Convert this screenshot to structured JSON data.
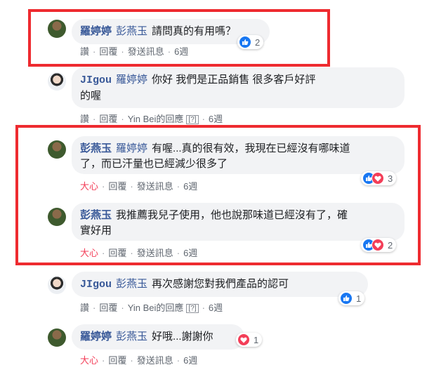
{
  "actions": {
    "like": "讚",
    "love": "大心",
    "reply": "回覆",
    "send": "發送訊息",
    "sep": "·",
    "reply_info_tag": "[?]"
  },
  "comments": [
    {
      "author": "羅婷婷",
      "tag": "彭燕玉",
      "text": "請問真的有用嗎？",
      "reaction": "like",
      "time": "6週",
      "reactions": "2"
    },
    {
      "author": "JIgou",
      "tag": "羅婷婷",
      "text_line1": "你好 我們是正品銷售 很多客戶好評",
      "text_line2": "的喔",
      "reaction": "like",
      "reply_info": "Yin Bei的回應",
      "time": "6週"
    },
    {
      "author": "彭燕玉",
      "tag": "羅婷婷",
      "text_line1": "有喔...真的很有效，我現在已經沒有哪味道",
      "text_line2": "了，而已汗量也已經減少很多了",
      "reaction": "love",
      "time": "6週",
      "reactions": "3"
    },
    {
      "author": "彭燕玉",
      "text_line1": "我推薦我兒子使用，他也說那味道已經沒有了，確",
      "text_line2": "實好用",
      "reaction": "love",
      "time": "6週",
      "reactions": "2"
    },
    {
      "author": "JIgou",
      "tag": "彭燕玉",
      "text": "再次感謝您對我們產品的認可",
      "reaction": "like",
      "reply_info": "Yin Bei的回應",
      "time": "6週",
      "reactions": "1"
    },
    {
      "author": "羅婷婷",
      "tag": "彭燕玉",
      "text": "好哦...謝謝你",
      "reaction": "love",
      "time": "6週",
      "reactions": "1"
    }
  ],
  "colors": {
    "highlight": "#ee2b30",
    "name": "#385898",
    "like": "#1877f2",
    "love": "#f33e58"
  }
}
